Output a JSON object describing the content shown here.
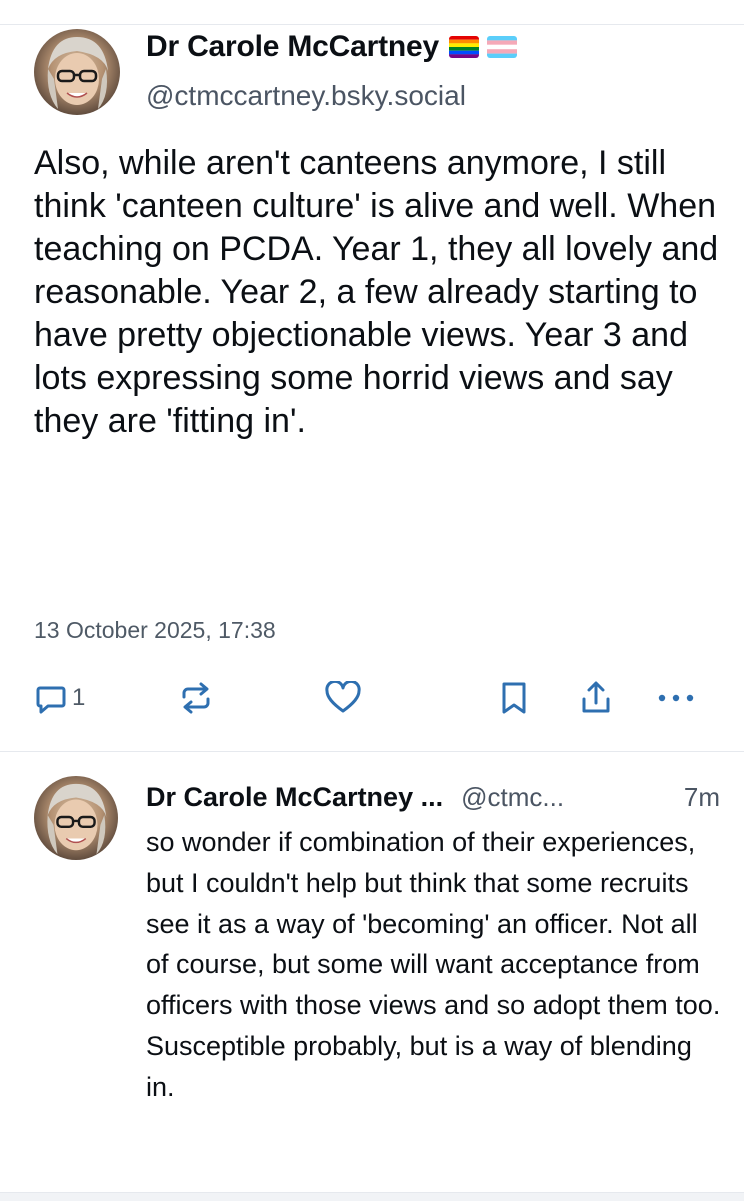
{
  "post": {
    "author_name": "Dr Carole McCartney",
    "author_flags": [
      "rainbow-flag-icon",
      "transgender-flag-icon"
    ],
    "handle": "@ctmccartney.bsky.social",
    "text": "Also, while aren't canteens anymore, I still think 'canteen culture' is alive and well. When teaching on PCDA. Year 1, they all lovely and reasonable. Year 2, a few already starting to have pretty objectionable views. Year 3 and lots expressing some horrid views and say they are 'fitting in'.",
    "date": "13 October 2025, 17:38",
    "reply_count": "1",
    "actions": [
      "reply-icon",
      "repost-icon",
      "like-icon",
      "bookmark-icon",
      "share-icon",
      "more-icon"
    ]
  },
  "reply": {
    "author_name": "Dr Carole McCartney ...",
    "handle": "@ctmc...",
    "time": "7m",
    "text": "so wonder if combination of their experiences, but I couldn't help but think that some recruits see it as a way of 'becoming' an officer. Not all of course, but some will want acceptance from officers with those views and so adopt them too. Susceptible probably, but is a way of blending in."
  },
  "colors": {
    "text": "#0b0f14",
    "muted": "#4f5a66",
    "icon": "#2e6fb0",
    "divider": "#e6e9ee"
  }
}
